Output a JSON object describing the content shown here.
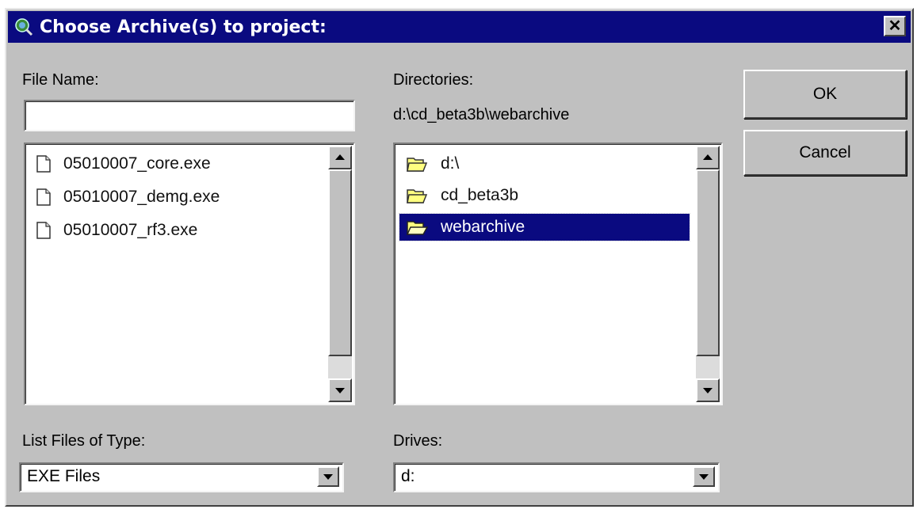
{
  "window": {
    "title": "Choose Archive(s) to project:",
    "close_glyph": "✕"
  },
  "file_name": {
    "label": "File Name:",
    "value": ""
  },
  "files": [
    {
      "name": "05010007_core.exe",
      "icon": "file-icon"
    },
    {
      "name": "05010007_demg.exe",
      "icon": "file-icon"
    },
    {
      "name": "05010007_rf3.exe",
      "icon": "file-icon"
    }
  ],
  "directories": {
    "label": "Directories:",
    "path": "d:\\cd_beta3b\\webarchive",
    "items": [
      {
        "name": "d:\\",
        "icon": "folder-icon",
        "selected": false
      },
      {
        "name": "cd_beta3b",
        "icon": "folder-icon",
        "selected": false
      },
      {
        "name": "webarchive",
        "icon": "open-folder-icon",
        "selected": true
      }
    ]
  },
  "buttons": {
    "ok": "OK",
    "cancel": "Cancel"
  },
  "file_type": {
    "label": "List Files of Type:",
    "value": "EXE Files"
  },
  "drives": {
    "label": "Drives:",
    "value": "d:"
  },
  "colors": {
    "title_bar": "#0a0a80",
    "face": "#c0c0c0",
    "selection": "#0a0a80",
    "folder": "#ffff80"
  }
}
